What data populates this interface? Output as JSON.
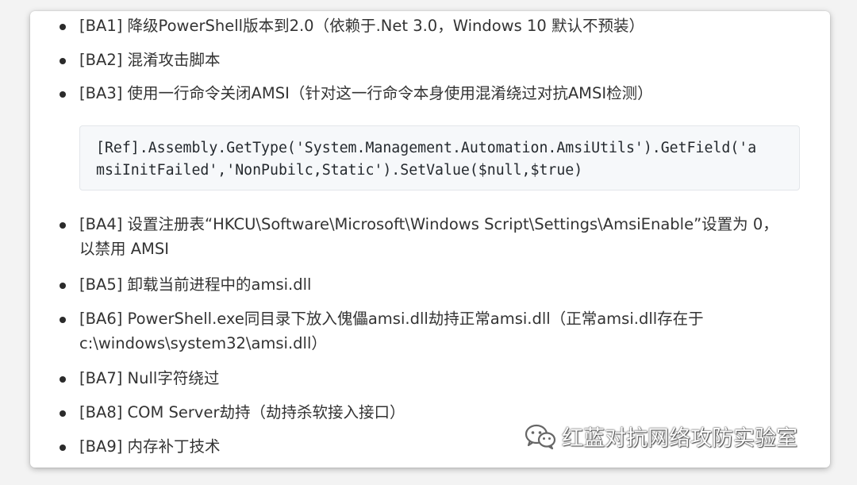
{
  "items": [
    {
      "text": "[BA1] 降级PowerShell版本到2.0（依赖于.Net 3.0，Windows 10 默认不预装）"
    },
    {
      "text": "[BA2] 混淆攻击脚本"
    },
    {
      "text": "[BA3] 使用一行命令关闭AMSI（针对这一行命令本身使用混淆绕过对抗AMSI检测）"
    },
    {
      "text": "[BA4] 设置注册表“HKCU\\Software\\Microsoft\\Windows Script\\Settings\\AmsiEnable”设置为 0，",
      "text2": "以禁用 AMSI"
    },
    {
      "text": "[BA5] 卸载当前进程中的amsi.dll"
    },
    {
      "text": "[BA6] PowerShell.exe同目录下放入傀儡amsi.dll劫持正常amsi.dll（正常amsi.dll存在于",
      "text2": "c:\\windows\\system32\\amsi.dll）"
    },
    {
      "text": "[BA7] Null字符绕过"
    },
    {
      "text": "[BA8] COM Server劫持（劫持杀软接入接口）"
    },
    {
      "text": "[BA9] 内存补丁技术"
    }
  ],
  "code": {
    "line1": "[Ref].Assembly.GetType('System.Management.Automation.AmsiUtils').GetField('a",
    "line2": "msiInitFailed','NonPubilc,Static').SetValue($null,$true)"
  },
  "watermark": {
    "text": "红蓝对抗网络攻防实验室",
    "icon": "wechat-icon"
  }
}
